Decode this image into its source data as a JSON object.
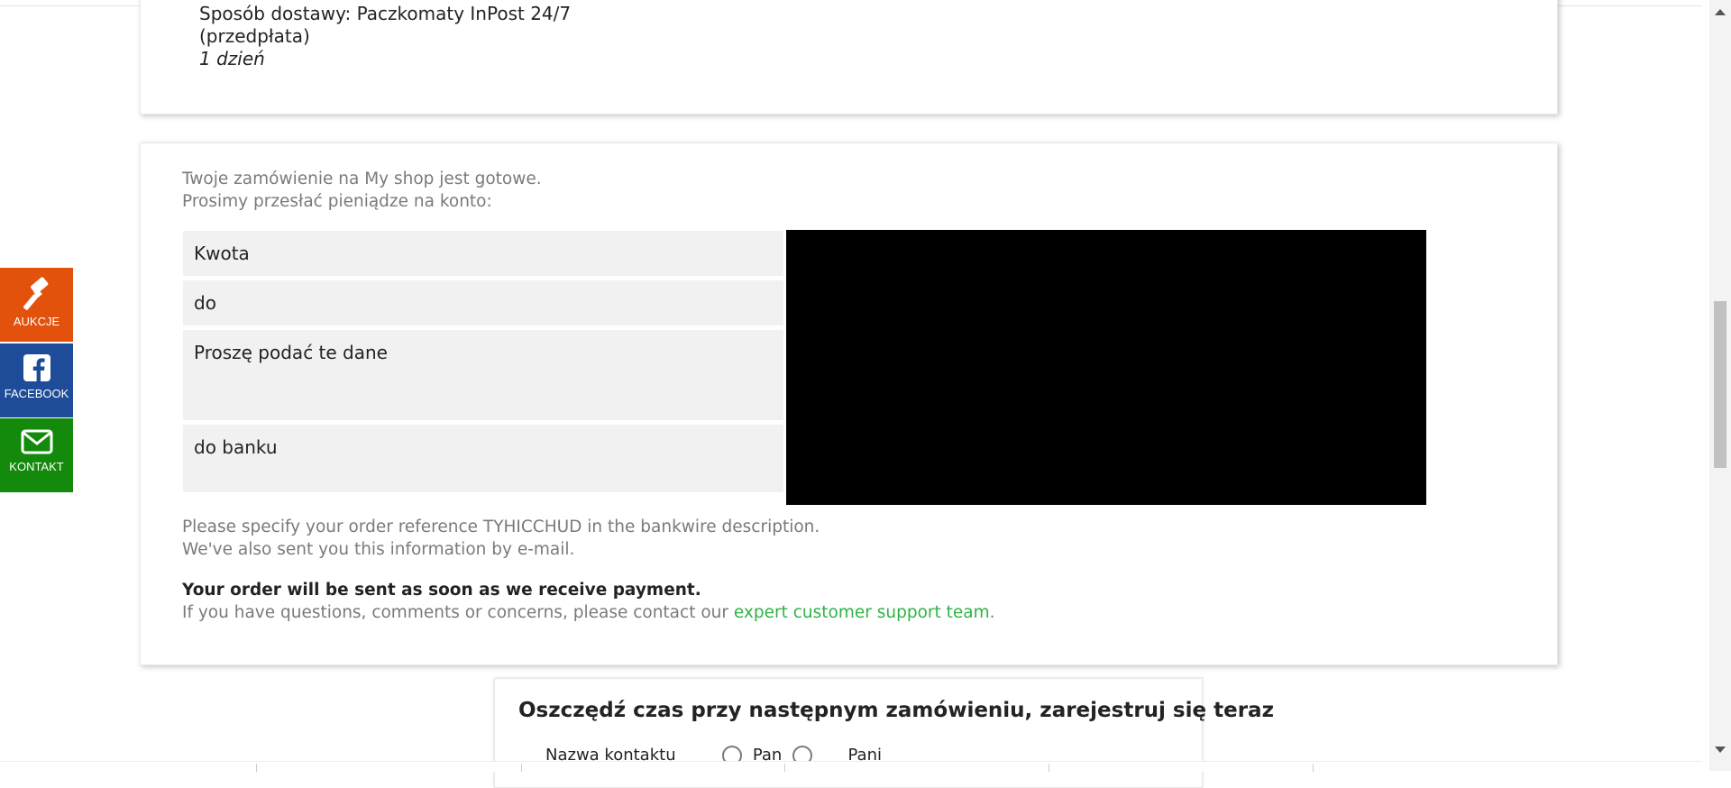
{
  "delivery": {
    "method_line": "Sposób dostawy: Paczkomaty InPost 24/7",
    "prepaid_line": "(przedpłata)",
    "duration": "1 dzień"
  },
  "payment": {
    "intro_line1": "Twoje zamówienie na My shop jest gotowe.",
    "intro_line2": "Prosimy przesłać pieniądze na konto:",
    "rows": [
      "Kwota",
      "do",
      "Proszę podać te dane",
      "do banku"
    ],
    "ref_line1": "Please specify your order reference TYHICCHUD in the bankwire description.",
    "ref_line2": "We've also sent you this information by e-mail.",
    "notice_bold": "Your order will be sent as soon as we receive payment.",
    "notice_text": "If you have questions, comments or concerns, please contact our",
    "support_link": "expert customer support team",
    "notice_end": "."
  },
  "register": {
    "title": "Oszczędź czas przy następnym zamówieniu, zarejestruj się teraz",
    "contact_label": "Nazwa kontaktu",
    "option_pan": "Pan",
    "option_pani": "Pani"
  },
  "sidebar": {
    "aukcje": "AUKCJE",
    "facebook": "FACEBOOK",
    "kontakt": "KONTAKT"
  },
  "colors": {
    "aukcje": "#e3520c",
    "facebook": "#1e4c98",
    "kontakt": "#138a0b",
    "link": "#2fb346"
  }
}
